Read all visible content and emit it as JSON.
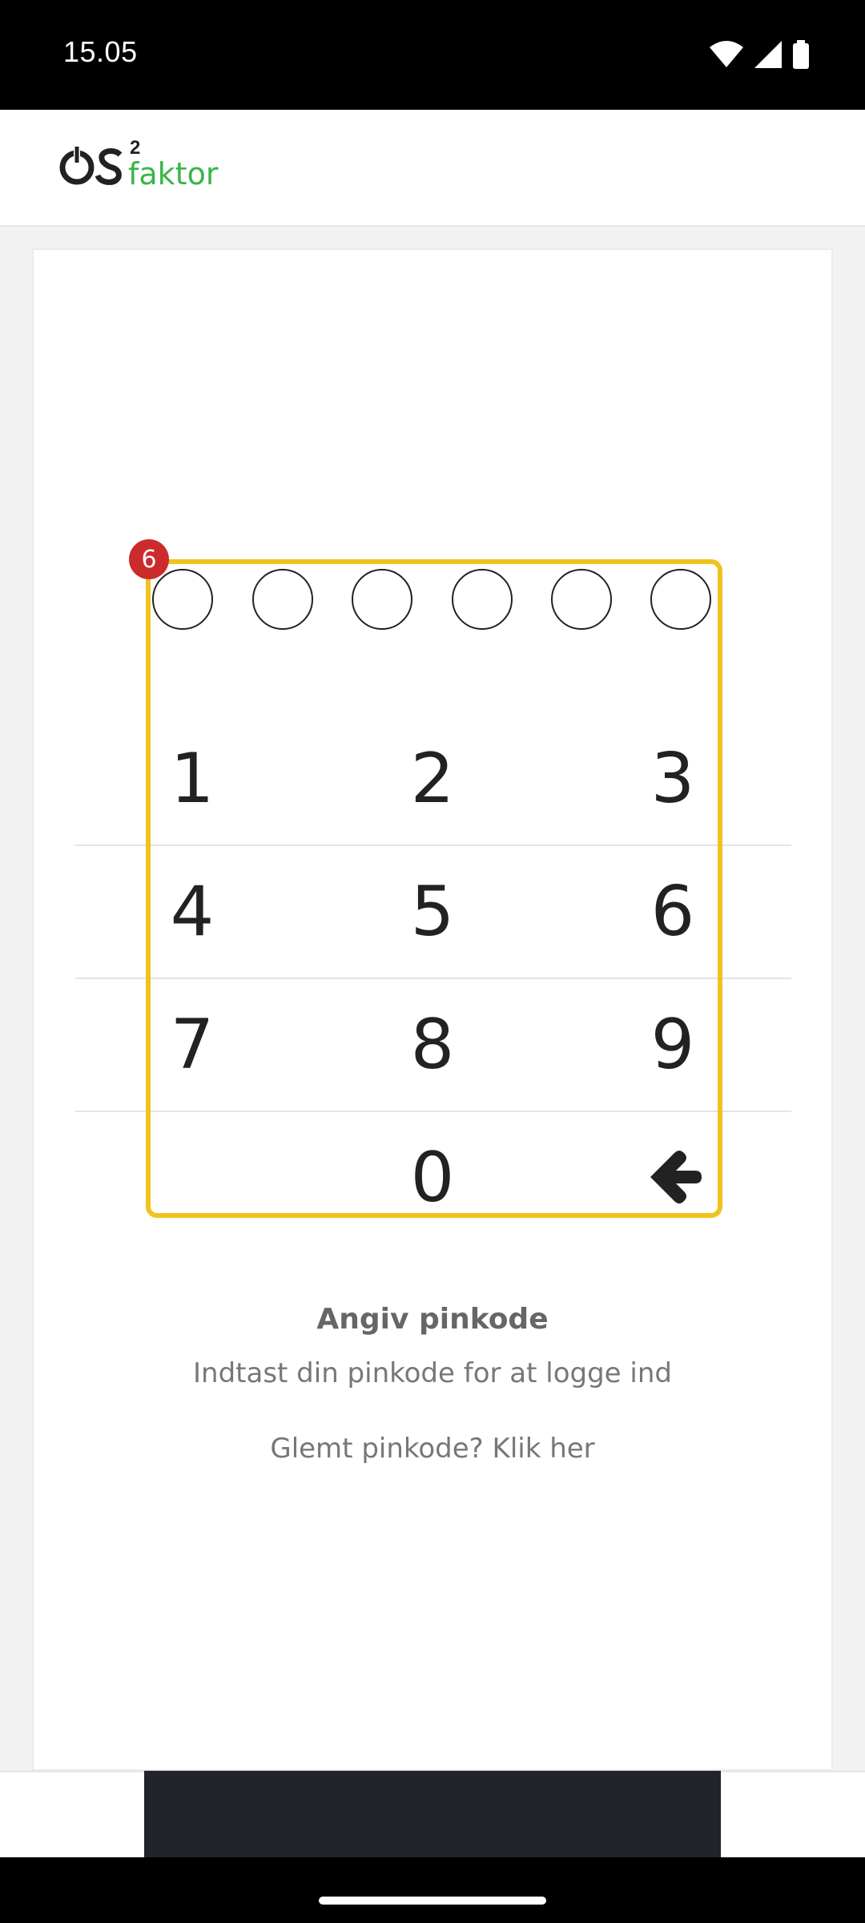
{
  "status_bar": {
    "time": "15.05",
    "icons": [
      "wifi-icon",
      "cellular-signal-icon",
      "battery-icon"
    ]
  },
  "header": {
    "logo_main": "OS",
    "logo_superscript": "2",
    "logo_sub": "faktor",
    "brand_color": "#3db34a"
  },
  "pin": {
    "dot_count": 6,
    "badge": "6",
    "highlight_color": "#f0c21e"
  },
  "keypad": {
    "rows": [
      [
        "1",
        "2",
        "3"
      ],
      [
        "4",
        "5",
        "6"
      ],
      [
        "7",
        "8",
        "9"
      ],
      [
        "",
        "0",
        "backspace-icon"
      ]
    ]
  },
  "prompt": {
    "title": "Angiv pinkode",
    "subtitle": "Indtast din pinkode for at logge ind",
    "forgot": "Glemt pinkode? Klik her"
  }
}
